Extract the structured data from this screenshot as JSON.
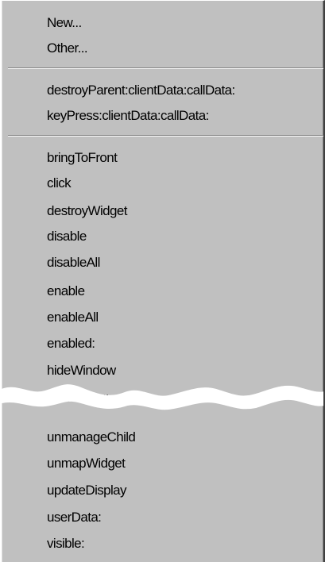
{
  "menu": {
    "group1": [
      "New...",
      "Other..."
    ],
    "group2": [
      "destroyParent:clientData:callData:",
      "keyPress:clientData:callData:"
    ],
    "group3": [
      "bringToFront",
      "click",
      "destroyWidget",
      "disable",
      "disableAll",
      "enable",
      "enableAll",
      "enabled:",
      "hideWindow",
      "labelString:"
    ],
    "group4": [
      "unmanageChild",
      "unmapWidget",
      "updateDisplay",
      "userData:",
      "visible:"
    ]
  },
  "colors": {
    "menu_background": "#c0c0c0",
    "text": "#000000",
    "separator_dark": "#808080",
    "separator_light": "#ffffff"
  }
}
